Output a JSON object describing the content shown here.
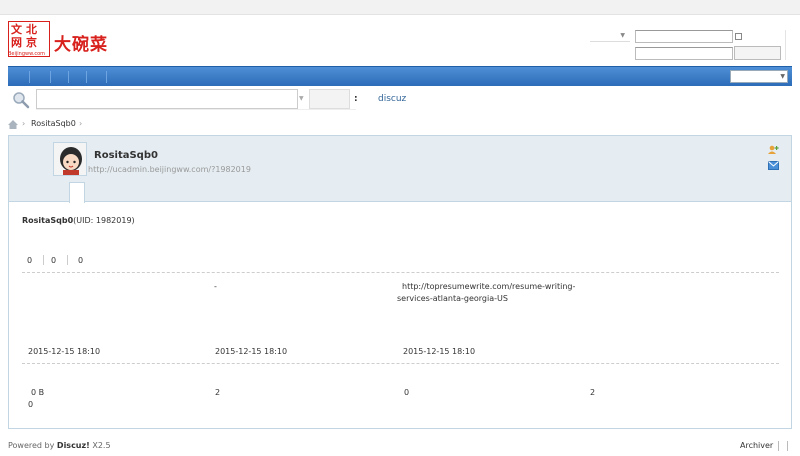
{
  "header": {
    "logo_cn": "大碗菜",
    "logo_mark": [
      "文",
      "北",
      "网",
      "京"
    ],
    "logo_domain": "Beijingww.com"
  },
  "search": {
    "hot_colon": ":",
    "hot_keyword": "discuz"
  },
  "breadcrumb": {
    "sep": "›",
    "user": "RositaSqb0"
  },
  "profile": {
    "username": "RositaSqb0",
    "space_url": "http://ucadmin.beijingww.com/?1982019",
    "uid_name": "RositaSqb0",
    "uid_text": "(UID: 1982019)",
    "stats": [
      "0",
      "0",
      "0"
    ],
    "row1": {
      "dash": "-",
      "homepage_line1": "http://topresumewrite.com/resume-writing-",
      "homepage_line2": "services-atlanta-georgia-US"
    },
    "dates": [
      "2015-12-15 18:10",
      "2015-12-15 18:10",
      "2015-12-15 18:10"
    ],
    "row3": {
      "space_used": "0 B",
      "a": "2",
      "b": "0",
      "c": "2",
      "d": "0"
    }
  },
  "footer": {
    "powered_by": "Powered by",
    "brand": "Discuz!",
    "version": "X2.5",
    "archiver": "Archiver"
  },
  "colors": {
    "nav_blue": "#2c6cb8",
    "logo_red": "#d8201c",
    "panel_bg": "#e5edf2",
    "link_blue": "#336699"
  }
}
